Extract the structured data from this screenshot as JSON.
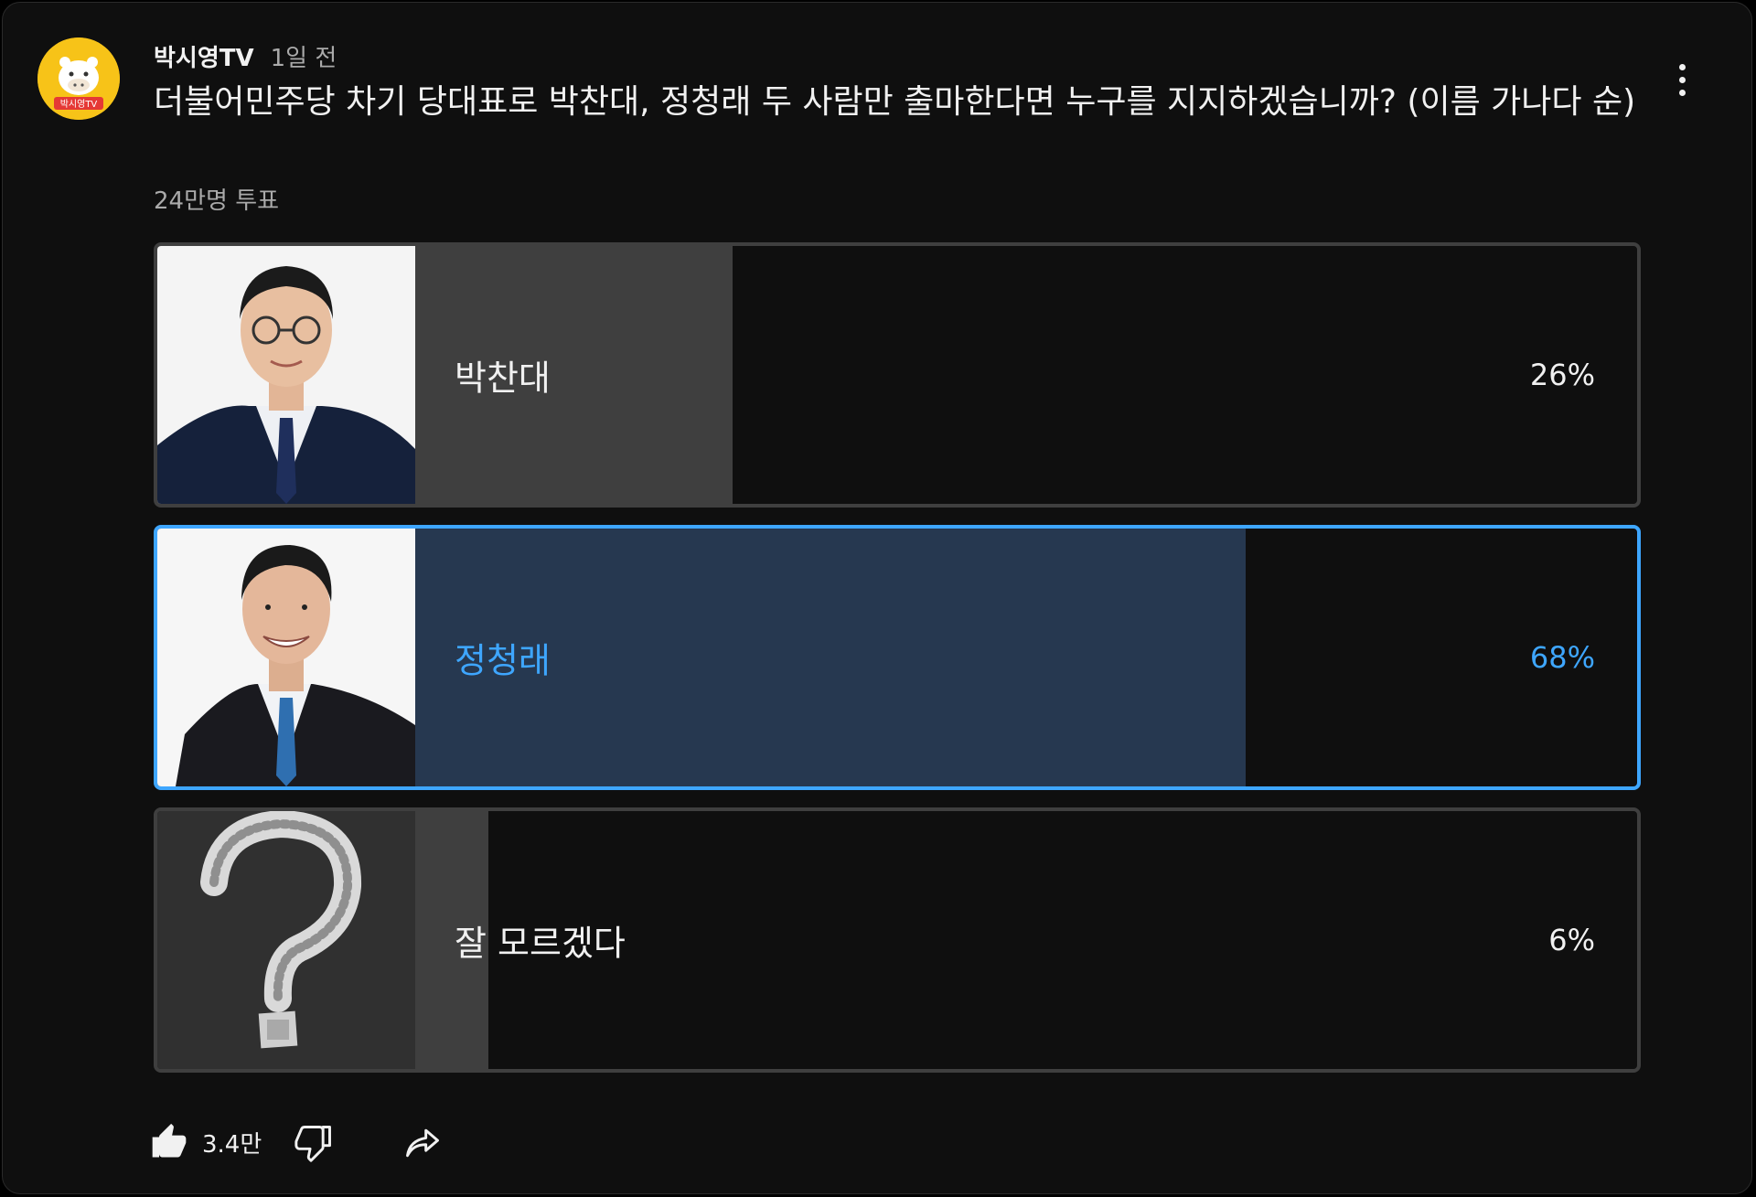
{
  "post": {
    "channel_name": "박시영TV",
    "time_ago": "1일 전",
    "title": "더불어민주당 차기 당대표로  박찬대, 정청래 두 사람만 출마한다면 누구를 지지하겠습니까? (이름 가나다 순)",
    "vote_count": "24만명 투표",
    "avatar_text": "박시영TV"
  },
  "poll": {
    "options": [
      {
        "label": "박찬대",
        "percent_text": "26%",
        "percent": 26,
        "selected": false,
        "image": "candidate-photo-park"
      },
      {
        "label": "정청래",
        "percent_text": "68%",
        "percent": 68,
        "selected": true,
        "image": "candidate-photo-jung"
      },
      {
        "label": "잘 모르겠다",
        "percent_text": "6%",
        "percent": 6,
        "selected": false,
        "image": "question-mark-chalk"
      }
    ]
  },
  "actions": {
    "like_count": "3.4만",
    "icons": [
      "thumbs-up-icon",
      "thumbs-down-icon",
      "share-icon",
      "more-vert-icon"
    ]
  },
  "colors": {
    "background": "#0f0f0f",
    "text": "#f1f1f1",
    "secondary_text": "#aaaaaa",
    "accent": "#3ea6ff",
    "selected_fill": "#263850",
    "fill": "#3f3f3f",
    "avatar": "#f7c318"
  }
}
